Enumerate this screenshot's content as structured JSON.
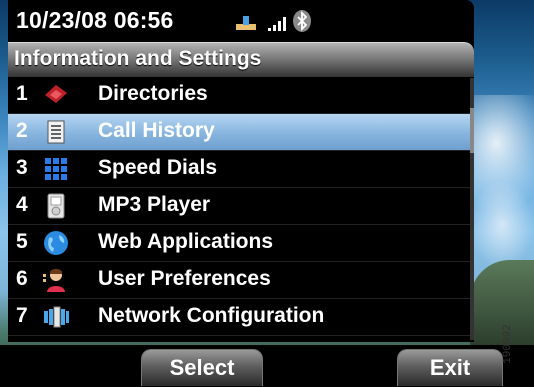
{
  "status_bar": {
    "datetime": "10/23/08 06:56",
    "icons": [
      "line-status-icon",
      "signal-strength-icon",
      "bluetooth-icon"
    ]
  },
  "title": "Information and Settings",
  "menu": {
    "selected_index": 1,
    "items": [
      {
        "num": "1",
        "label": "Directories",
        "icon": "directory-book-icon"
      },
      {
        "num": "2",
        "label": "Call History",
        "icon": "call-history-icon"
      },
      {
        "num": "3",
        "label": "Speed Dials",
        "icon": "speed-dial-grid-icon"
      },
      {
        "num": "4",
        "label": "MP3 Player",
        "icon": "mp3-player-icon"
      },
      {
        "num": "5",
        "label": "Web Applications",
        "icon": "globe-icon"
      },
      {
        "num": "6",
        "label": "User Preferences",
        "icon": "user-icon"
      },
      {
        "num": "7",
        "label": "Network Configuration",
        "icon": "network-icon"
      }
    ]
  },
  "softkeys": {
    "left": "Select",
    "right": "Exit"
  },
  "serial": "190092",
  "colors": {
    "selection": "#8ab7e0",
    "panel": "#000000"
  }
}
